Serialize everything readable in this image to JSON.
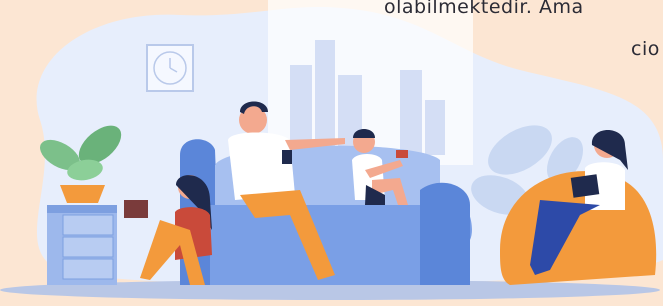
{
  "text": {
    "line1": "olabilmektedir. Ama",
    "line2": "cio"
  },
  "illustration": {
    "subject": "family-relaxing-on-couch-with-devices",
    "colors": {
      "background": "#fce6d3",
      "blob": "#e7eefc",
      "sofa": "#5b86d9",
      "sofa_light": "#a7c0f0",
      "orange": "#f39a3c",
      "floor_shadow": "#b9c7e6",
      "skin": "#f3a98f",
      "dark_hair": "#1f2a4d"
    }
  }
}
